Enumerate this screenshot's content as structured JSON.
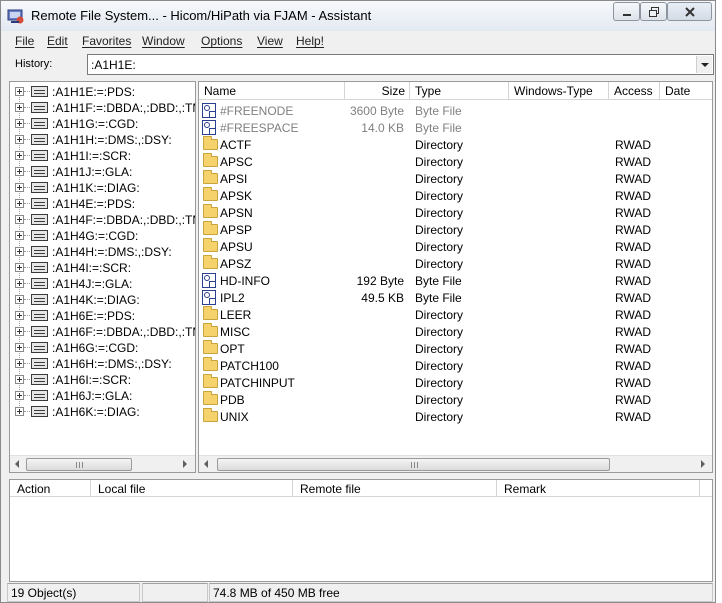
{
  "window": {
    "title": "Remote File System... - Hicom/HiPath via FJAM - Assistant"
  },
  "menu": [
    "File",
    "Edit",
    "Favorites",
    "Window",
    "Options",
    "View",
    "Help!"
  ],
  "history": {
    "label": "History:",
    "value": ":A1H1E:"
  },
  "tree": {
    "items": [
      ":A1H1E:=:PDS:",
      ":A1H1F:=:DBDA:,:DBD:,:TMD",
      ":A1H1G:=:CGD:",
      ":A1H1H:=:DMS:,:DSY:",
      ":A1H1I:=:SCR:",
      ":A1H1J:=:GLA:",
      ":A1H1K:=:DIAG:",
      ":A1H4E:=:PDS:",
      ":A1H4F:=:DBDA:,:DBD:,:TMD",
      ":A1H4G:=:CGD:",
      ":A1H4H:=:DMS:,:DSY:",
      ":A1H4I:=:SCR:",
      ":A1H4J:=:GLA:",
      ":A1H4K:=:DIAG:",
      ":A1H6E:=:PDS:",
      ":A1H6F:=:DBDA:,:DBD:,:TMD",
      ":A1H6G:=:CGD:",
      ":A1H6H:=:DMS:,:DSY:",
      ":A1H6I:=:SCR:",
      ":A1H6J:=:GLA:",
      ":A1H6K:=:DIAG:"
    ]
  },
  "files": {
    "columns": [
      "Name",
      "Size",
      "Type",
      "Windows-Type",
      "Access",
      "Date"
    ],
    "rows": [
      {
        "name": "#FREENODE",
        "size": "3600 Byte",
        "type": "Byte File",
        "access": "",
        "icon": "file-icon",
        "gray": true
      },
      {
        "name": "#FREESPACE",
        "size": "14.0 KB",
        "type": "Byte File",
        "access": "",
        "icon": "file-icon",
        "gray": true
      },
      {
        "name": "ACTF",
        "size": "",
        "type": "Directory",
        "access": "RWAD",
        "icon": "folder-icon",
        "gray": false
      },
      {
        "name": "APSC",
        "size": "",
        "type": "Directory",
        "access": "RWAD",
        "icon": "folder-icon",
        "gray": false
      },
      {
        "name": "APSI",
        "size": "",
        "type": "Directory",
        "access": "RWAD",
        "icon": "folder-icon",
        "gray": false
      },
      {
        "name": "APSK",
        "size": "",
        "type": "Directory",
        "access": "RWAD",
        "icon": "folder-icon",
        "gray": false
      },
      {
        "name": "APSN",
        "size": "",
        "type": "Directory",
        "access": "RWAD",
        "icon": "folder-icon",
        "gray": false
      },
      {
        "name": "APSP",
        "size": "",
        "type": "Directory",
        "access": "RWAD",
        "icon": "folder-icon",
        "gray": false
      },
      {
        "name": "APSU",
        "size": "",
        "type": "Directory",
        "access": "RWAD",
        "icon": "folder-icon",
        "gray": false
      },
      {
        "name": "APSZ",
        "size": "",
        "type": "Directory",
        "access": "RWAD",
        "icon": "folder-icon",
        "gray": false
      },
      {
        "name": "HD-INFO",
        "size": "192 Byte",
        "type": "Byte File",
        "access": "RWAD",
        "icon": "file-icon",
        "gray": false
      },
      {
        "name": "IPL2",
        "size": "49.5 KB",
        "type": "Byte File",
        "access": "RWAD",
        "icon": "file-icon",
        "gray": false
      },
      {
        "name": "LEER",
        "size": "",
        "type": "Directory",
        "access": "RWAD",
        "icon": "folder-icon",
        "gray": false
      },
      {
        "name": "MISC",
        "size": "",
        "type": "Directory",
        "access": "RWAD",
        "icon": "folder-icon",
        "gray": false
      },
      {
        "name": "OPT",
        "size": "",
        "type": "Directory",
        "access": "RWAD",
        "icon": "folder-icon",
        "gray": false
      },
      {
        "name": "PATCH100",
        "size": "",
        "type": "Directory",
        "access": "RWAD",
        "icon": "folder-icon",
        "gray": false
      },
      {
        "name": "PATCHINPUT",
        "size": "",
        "type": "Directory",
        "access": "RWAD",
        "icon": "folder-icon",
        "gray": false
      },
      {
        "name": "PDB",
        "size": "",
        "type": "Directory",
        "access": "RWAD",
        "icon": "folder-icon",
        "gray": false
      },
      {
        "name": "UNIX",
        "size": "",
        "type": "Directory",
        "access": "RWAD",
        "icon": "folder-icon",
        "gray": false
      }
    ]
  },
  "log": {
    "columns": [
      "Action",
      "Local file",
      "Remote file",
      "Remark"
    ]
  },
  "status": {
    "objects": "19 Object(s)",
    "free": "74.8 MB  of  450 MB free"
  },
  "colors": {
    "gray_text": "#808080",
    "folder": "#f5d26b",
    "file_icon": "#2a3f8f"
  }
}
